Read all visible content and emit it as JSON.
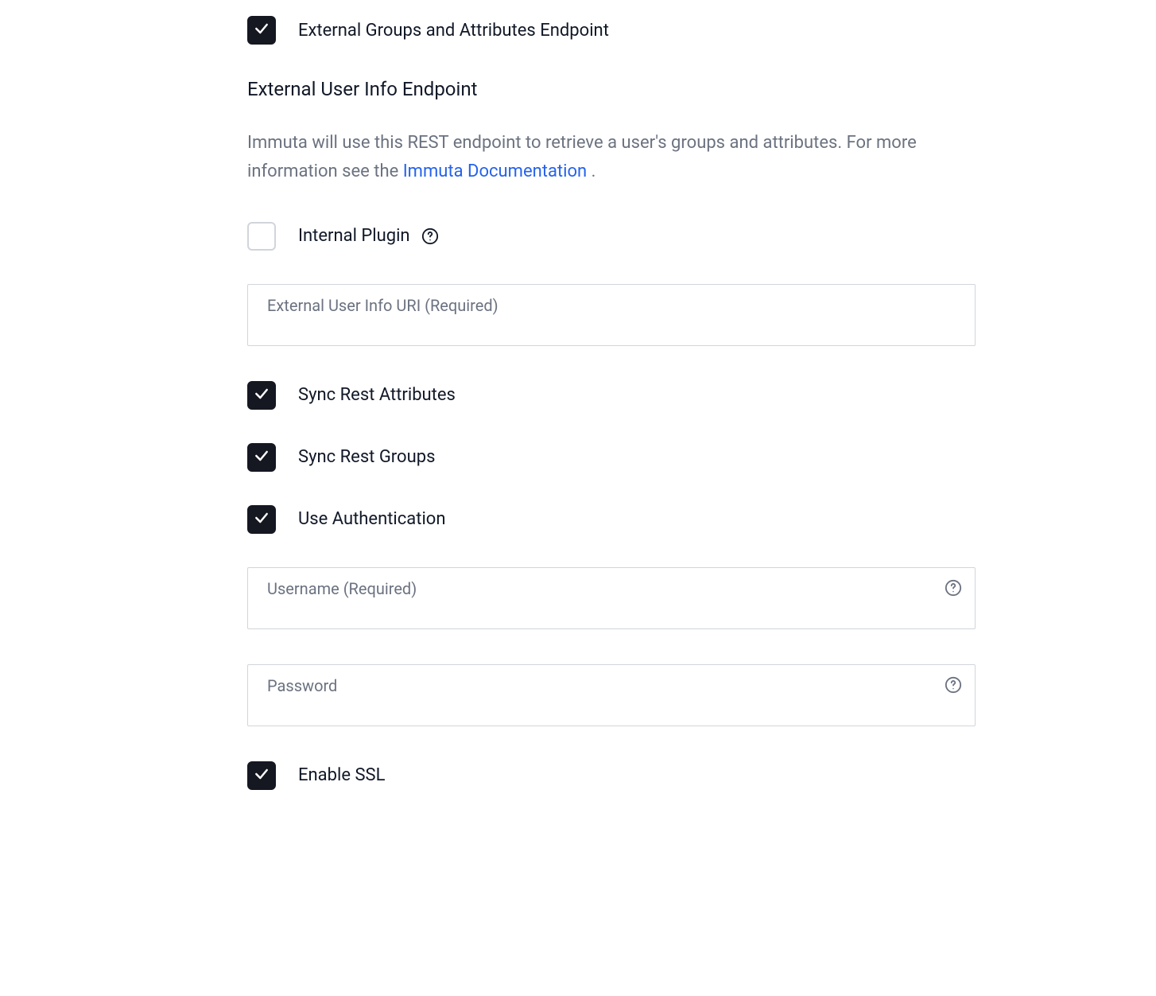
{
  "checkboxes": {
    "external_groups_attributes": {
      "label": "External Groups and Attributes Endpoint",
      "checked": true
    },
    "internal_plugin": {
      "label": "Internal Plugin",
      "checked": false
    },
    "sync_rest_attributes": {
      "label": "Sync Rest Attributes",
      "checked": true
    },
    "sync_rest_groups": {
      "label": "Sync Rest Groups",
      "checked": true
    },
    "use_authentication": {
      "label": "Use Authentication",
      "checked": true
    },
    "enable_ssl": {
      "label": "Enable SSL",
      "checked": true
    }
  },
  "section": {
    "heading": "External User Info Endpoint",
    "description_prefix": "Immuta will use this REST endpoint to retrieve a user's groups and attributes. For more information see the ",
    "description_link": "Immuta Documentation",
    "description_suffix": " ."
  },
  "inputs": {
    "external_user_info_uri": {
      "label": "External User Info URI (Required)",
      "value": ""
    },
    "username": {
      "label": "Username (Required)",
      "value": ""
    },
    "password": {
      "label": "Password",
      "value": ""
    }
  }
}
